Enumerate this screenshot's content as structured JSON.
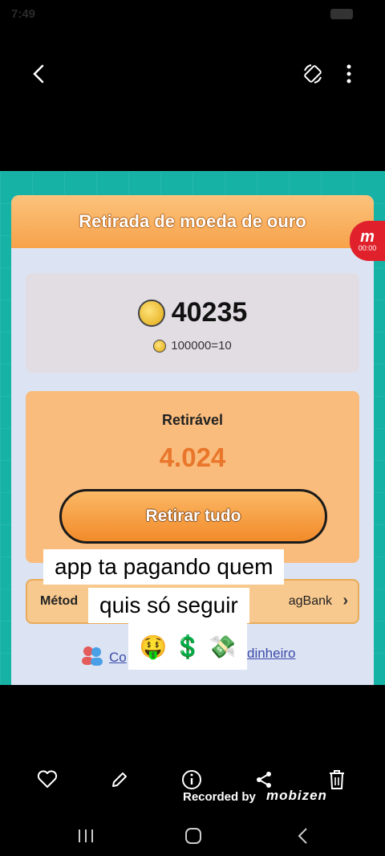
{
  "status_bar": {
    "time": "7:49"
  },
  "header": {
    "back_icon": "chevron-left-icon",
    "rotate_icon": "rotate-screen-icon",
    "menu_icon": "more-vertical-icon"
  },
  "app": {
    "title": "Retirada de moeda de ouro",
    "recorder_badge": {
      "logo": "m",
      "time": "00:00"
    },
    "balance": {
      "value": "40235",
      "rate": "100000=10"
    },
    "withdraw": {
      "label": "Retirável",
      "value": "4.024",
      "button_label": "Retirar tudo"
    },
    "method": {
      "label": "Métod",
      "value": "agBank"
    },
    "help": {
      "prefix": "Co",
      "suffix": "dinheiro"
    }
  },
  "caption": {
    "line1": "app ta pagando quem",
    "line2": "quis só seguir",
    "emojis": [
      "🤑",
      "💲",
      "💸"
    ]
  },
  "toolbar": {
    "items": [
      "heart-icon",
      "edit-pencil-icon",
      "info-icon",
      "share-icon",
      "trash-icon"
    ]
  },
  "watermark": {
    "text": "Recorded by",
    "brand": "mobizen"
  },
  "nav": {
    "items": [
      "recent-apps-icon",
      "home-icon",
      "back-icon"
    ]
  },
  "colors": {
    "teal": "#16b2a6",
    "orange": "#f7a24a",
    "panel": "#dce4f4",
    "value": "#e9762a"
  }
}
